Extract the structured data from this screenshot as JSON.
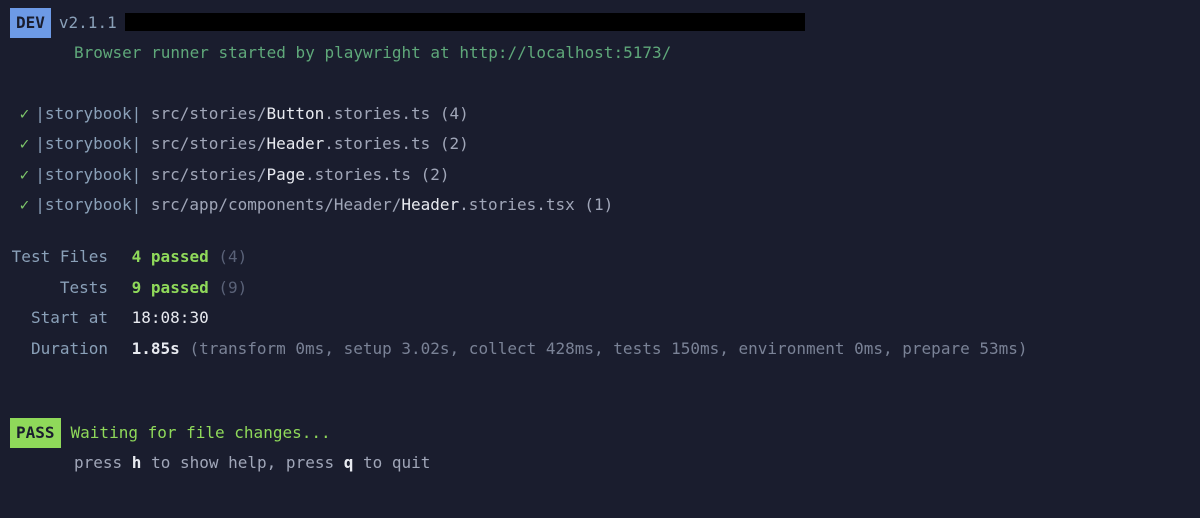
{
  "header": {
    "badge": "DEV",
    "version": "v2.1.1",
    "runner_msg": "Browser runner started by playwright at http://localhost:5173/"
  },
  "files": [
    {
      "tag": "|storybook|",
      "prefix": "src/stories/",
      "highlight": "Button",
      "suffix": ".stories.ts",
      "count": "(4)"
    },
    {
      "tag": "|storybook|",
      "prefix": "src/stories/",
      "highlight": "Header",
      "suffix": ".stories.ts",
      "count": "(2)"
    },
    {
      "tag": "|storybook|",
      "prefix": "src/stories/",
      "highlight": "Page",
      "suffix": ".stories.ts",
      "count": "(2)"
    },
    {
      "tag": "|storybook|",
      "prefix": "src/app/components/Header/",
      "highlight": "Header",
      "suffix": ".stories.tsx",
      "count": "(1)"
    }
  ],
  "summary": {
    "test_files_label": "Test Files",
    "test_files_passed": "4",
    "test_files_word": "passed",
    "test_files_total": "(4)",
    "tests_label": "Tests",
    "tests_passed": "9",
    "tests_word": "passed",
    "tests_total": "(9)",
    "start_at_label": "Start at",
    "start_at_val": "18:08:30",
    "duration_label": "Duration",
    "duration_val": "1.85s",
    "duration_breakdown": "(transform 0ms, setup 3.02s, collect 428ms, tests 150ms, environment 0ms, prepare 53ms)"
  },
  "footer": {
    "pass_badge": "PASS",
    "waiting": "Waiting for file changes...",
    "hint_press1": "press ",
    "hint_key1": "h",
    "hint_mid": " to show help, press ",
    "hint_key2": "q",
    "hint_end": " to quit"
  }
}
